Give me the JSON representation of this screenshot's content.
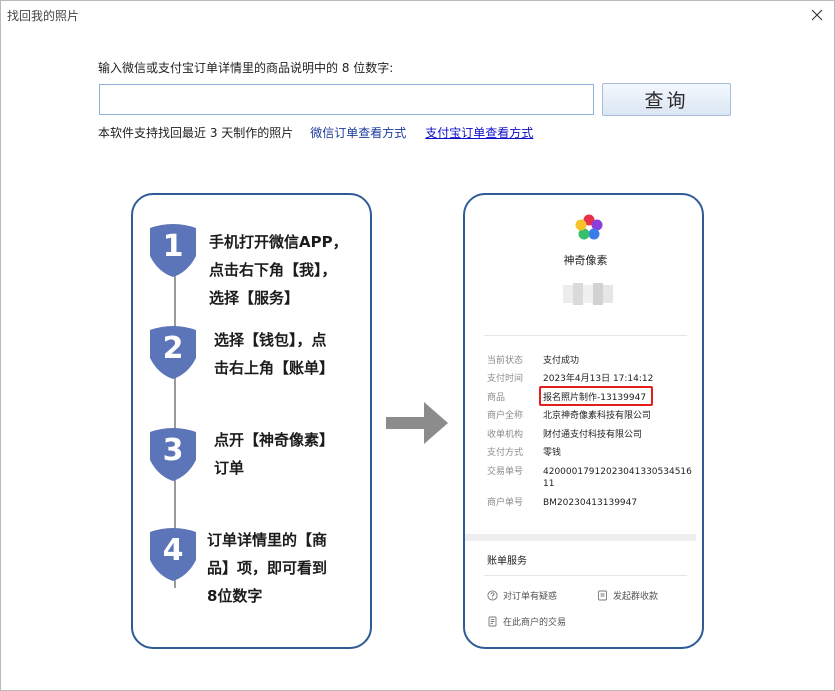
{
  "window": {
    "title": "找回我的照片"
  },
  "form": {
    "prompt": "输入微信或支付宝订单详情里的商品说明中的 8 位数字:",
    "input_value": "",
    "input_placeholder": "",
    "search_label": "查询",
    "note": "本软件支持找回最近 3 天制作的照片",
    "wechat_link": "微信订单查看方式",
    "alipay_link": "支付宝订单查看方式"
  },
  "steps": [
    {
      "number": "1",
      "lines": [
        "手机打开微信APP，",
        "点击右下角【我】，",
        "选择【服务】"
      ]
    },
    {
      "number": "2",
      "lines": [
        "选择【钱包】，点",
        "击右上角【账单】"
      ]
    },
    {
      "number": "3",
      "lines": [
        "点开【神奇像素】",
        "订单"
      ]
    },
    {
      "number": "4",
      "lines": [
        "订单详情里的【商",
        "品】项，即可看到",
        "8位数字"
      ]
    }
  ],
  "receipt": {
    "merchant_name": "神奇像素",
    "details": [
      {
        "key": "当前状态",
        "value": "支付成功"
      },
      {
        "key": "支付时间",
        "value": "2023年4月13日 17:14:12"
      },
      {
        "key": "商品",
        "value": "报名照片制作-13139947"
      },
      {
        "key": "商户全称",
        "value": "北京神奇像素科技有限公司"
      },
      {
        "key": "收单机构",
        "value": "财付通支付科技有限公司"
      },
      {
        "key": "支付方式",
        "value": "零钱"
      },
      {
        "key": "交易单号",
        "value": "4200001791202304133053451611"
      },
      {
        "key": "商户单号",
        "value": "BM20230413139947"
      }
    ],
    "bill_service": "账单服务",
    "actions": {
      "doubt": "对订单有疑惑",
      "group": "发起群收款",
      "trades": "在此商户的交易"
    }
  },
  "colors": {
    "accent": "#2f5c96",
    "badge": "#5b75b8",
    "highlight": "#e0201c",
    "link": "#1b3a9a"
  },
  "icons": {
    "close": "close-icon",
    "arrow": "arrow-right-icon",
    "logo": "flower-logo"
  }
}
